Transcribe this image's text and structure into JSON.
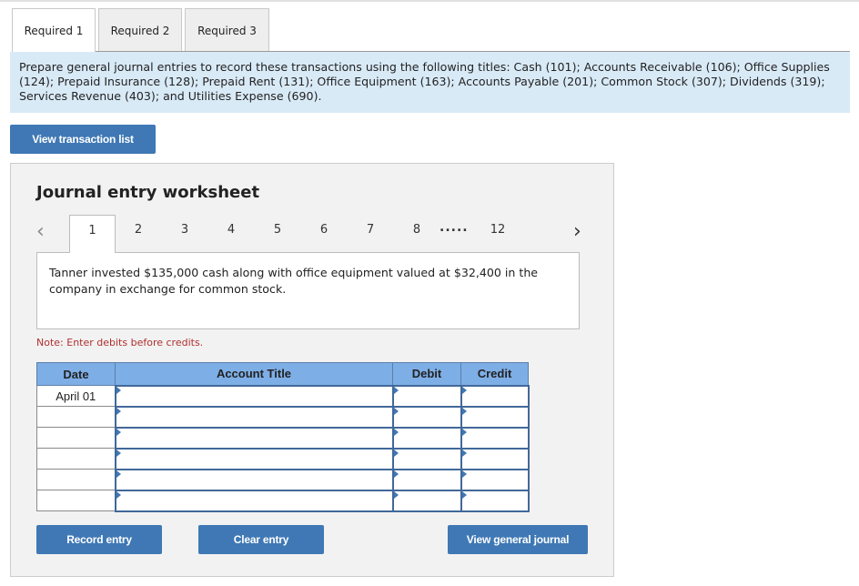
{
  "tabs": [
    {
      "label": "Required 1",
      "active": true
    },
    {
      "label": "Required 2",
      "active": false
    },
    {
      "label": "Required 3",
      "active": false
    }
  ],
  "instructions": "Prepare general journal entries to record these transactions using the following titles: Cash (101); Accounts Receivable (106); Office Supplies (124); Prepaid Insurance (128); Prepaid Rent (131); Office Equipment (163); Accounts Payable (201); Common Stock (307); Dividends (319); Services Revenue (403); and Utilities Expense (690).",
  "view_transaction_button": "View transaction list",
  "worksheet": {
    "title": "Journal entry worksheet",
    "prev_icon": "chevron-left-icon",
    "next_icon": "chevron-right-icon",
    "pages": [
      "1",
      "2",
      "3",
      "4",
      "5",
      "6",
      "7",
      "8"
    ],
    "ellipsis": ".....",
    "last_page": "12",
    "active_page": "1",
    "description": "Tanner invested $135,000 cash along with office equipment valued at $32,400 in the company in exchange for common stock.",
    "note": "Note: Enter debits before credits.",
    "columns": {
      "date": "Date",
      "account": "Account Title",
      "debit": "Debit",
      "credit": "Credit"
    },
    "rows": [
      {
        "date": "April 01",
        "account": "",
        "debit": "",
        "credit": ""
      },
      {
        "date": "",
        "account": "",
        "debit": "",
        "credit": ""
      },
      {
        "date": "",
        "account": "",
        "debit": "",
        "credit": ""
      },
      {
        "date": "",
        "account": "",
        "debit": "",
        "credit": ""
      },
      {
        "date": "",
        "account": "",
        "debit": "",
        "credit": ""
      },
      {
        "date": "",
        "account": "",
        "debit": "",
        "credit": ""
      }
    ],
    "record_button": "Record entry",
    "clear_button": "Clear entry",
    "general_journal_button": "View general journal"
  },
  "colors": {
    "accent": "#3f78b5",
    "header": "#7eaee6",
    "instructions_bg": "#d9eaf7",
    "note": "#b03030"
  }
}
